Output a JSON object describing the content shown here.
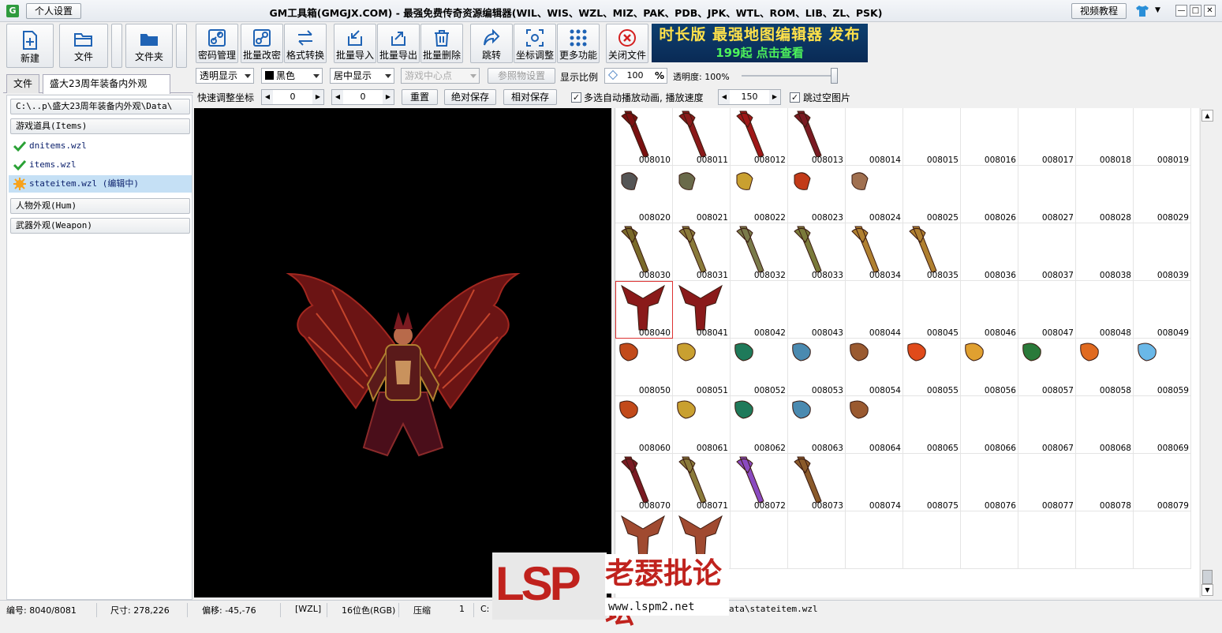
{
  "titlebar": {
    "app_icon": "G",
    "personal_settings": "个人设置",
    "title": "GM工具箱(GMGJX.COM) - 最强免费传奇资源编辑器(WIL、WIS、WZL、MIZ、PAK、PDB、JPK、WTL、ROM、LIB、ZL、PSK)",
    "video_tutorial": "视频教程",
    "min": "—",
    "max": "□",
    "close": "✕"
  },
  "left_toolbar": {
    "new": "新建",
    "file": "文件",
    "folder": "文件夹"
  },
  "left_tabs": {
    "tab1": "文件",
    "tab2": "盛大23周年装备内外观"
  },
  "tree": {
    "path": "C:\\..p\\盛大23周年装备内外观\\Data\\",
    "group_items": "游戏道具(Items)",
    "files": [
      "dnitems.wzl",
      "items.wzl",
      "stateitem.wzl (编辑中)"
    ],
    "group_hum": "人物外观(Hum)",
    "group_weapon": "武器外观(Weapon)"
  },
  "toolbar": {
    "password": "密码管理",
    "batch_decrypt": "批量改密",
    "format_convert": "格式转换",
    "batch_import": "批量导入",
    "batch_export": "批量导出",
    "batch_delete": "批量删除",
    "jump": "跳转",
    "coord_adjust": "坐标调整",
    "more": "更多功能",
    "close_file": "关闭文件"
  },
  "banner": {
    "line1": "时长版 最强地图编辑器 发布",
    "line2": "199起 点击查看"
  },
  "options": {
    "transparent_display": "透明显示",
    "bg_color": "黑色",
    "center_display": "居中显示",
    "game_center": "游戏中心点",
    "reference_settings": "参照物设置",
    "scale_label": "显示比例",
    "scale_value": "100",
    "scale_unit": "%",
    "opacity_label": "透明度: 100%",
    "opacity": 1.0,
    "quick_coord": "快速调整坐标",
    "coord_x": "0",
    "coord_y": "0",
    "reset": "重置",
    "abs_save": "绝对保存",
    "rel_save": "相对保存",
    "multi_anim": "多选自动播放动画, 播放速度",
    "speed": "150",
    "skip_empty": "跳过空图片"
  },
  "thumbnails": {
    "rows": [
      [
        "008010",
        "008011",
        "008012",
        "008013",
        "008014",
        "008015",
        "008016",
        "008017",
        "008018",
        "008019"
      ],
      [
        "008020",
        "008021",
        "008022",
        "008023",
        "008024",
        "008025",
        "008026",
        "008027",
        "008028",
        "008029"
      ],
      [
        "008030",
        "008031",
        "008032",
        "008033",
        "008034",
        "008035",
        "008036",
        "008037",
        "008038",
        "008039"
      ],
      [
        "008040",
        "008041",
        "008042",
        "008043",
        "008044",
        "008045",
        "008046",
        "008047",
        "008048",
        "008049"
      ],
      [
        "008050",
        "008051",
        "008052",
        "008053",
        "008054",
        "008055",
        "008056",
        "008057",
        "008058",
        "008059"
      ],
      [
        "008060",
        "008061",
        "008062",
        "008063",
        "008064",
        "008065",
        "008066",
        "008067",
        "008068",
        "008069"
      ],
      [
        "008070",
        "008071",
        "008072",
        "008073",
        "008074",
        "008075",
        "008076",
        "008077",
        "008078",
        "008079"
      ],
      [
        "",
        "",
        "",
        "",
        "",
        "",
        "",
        "",
        "",
        ""
      ]
    ],
    "selected": "008040"
  },
  "status": {
    "index": "编号: 8040/8081",
    "size": "尺寸: 278,226",
    "offset": "偏移: -45,-76",
    "format": "[WZL]",
    "color": "16位色(RGB)",
    "compress": "压缩",
    "compress_val": "1",
    "path_prefix": "C:",
    "path_suffix": "ata\\stateitem.wzl"
  },
  "watermark": {
    "logo": "LSP",
    "name": "老瑟批论坛",
    "url": "www.lspm2.net"
  }
}
